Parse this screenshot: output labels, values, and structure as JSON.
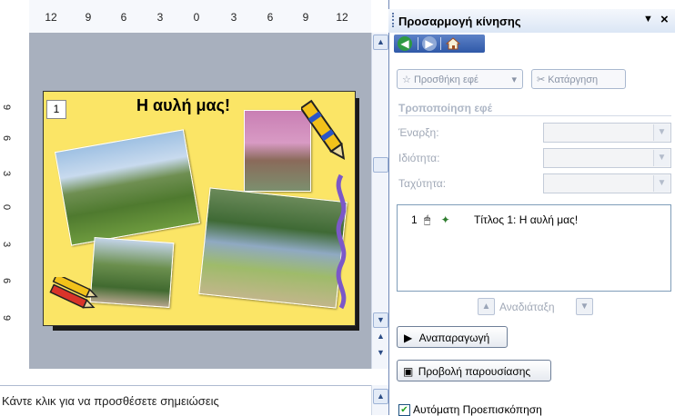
{
  "ruler": {
    "horizontal": [
      "12",
      "9",
      "6",
      "3",
      "0",
      "3",
      "6",
      "9",
      "12"
    ],
    "vertical": [
      "9",
      "6",
      "3",
      "0",
      "3",
      "6",
      "9"
    ]
  },
  "slide": {
    "number": "1",
    "title": "Η αυλή μας!"
  },
  "notes": {
    "placeholder": "Κάντε κλικ για να προσθέσετε σημειώσεις"
  },
  "task_pane": {
    "title": "Προσαρμογή κίνησης",
    "nav": {
      "back": "back-icon",
      "forward": "forward-icon",
      "home": "home-icon"
    },
    "add_effect_label": "Προσθήκη εφέ",
    "remove_label": "Κατάργηση",
    "modify_section_title": "Τροποποίηση εφέ",
    "fields": {
      "start_label": "Έναρξη:",
      "property_label": "Ιδιότητα:",
      "speed_label": "Ταχύτητα:"
    },
    "effects": [
      {
        "number": "1",
        "text": "Τίτλος 1: Η αυλή μας!"
      }
    ],
    "reorder_label": "Αναδιάταξη",
    "play_label": "Αναπαραγωγή",
    "slideshow_label": "Προβολή παρουσίασης",
    "autopreview": {
      "label": "Αυτόματη Προεπισκόπηση",
      "checked": true
    }
  },
  "colors": {
    "slide_bg": "#fbe566",
    "workarea": "#a8b0be",
    "pane_header": "#dbe6f5",
    "accent": "#2f59a8"
  }
}
